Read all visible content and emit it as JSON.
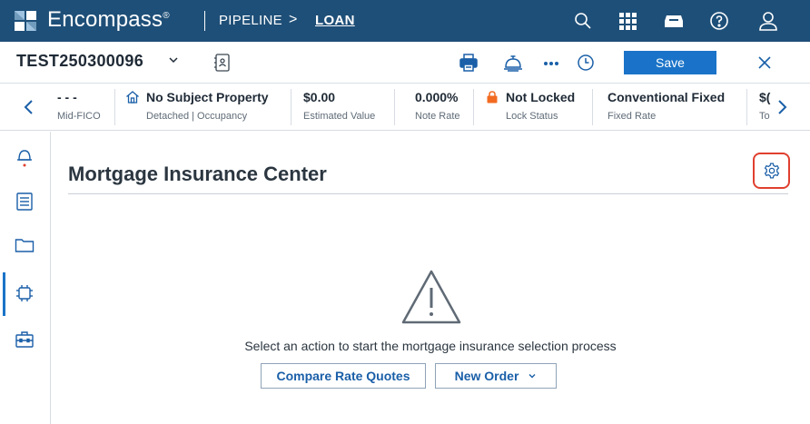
{
  "header": {
    "brand": "Encompass",
    "brand_mark": "®",
    "breadcrumb": {
      "pipeline": "PIPELINE",
      "separator": ">",
      "loan": "LOAN"
    },
    "icons": [
      "search-icon",
      "apps-grid-icon",
      "inbox-icon",
      "help-icon",
      "user-icon"
    ],
    "background": "#1e4f78"
  },
  "titlebar": {
    "loan_number": "TEST250300096",
    "icons": [
      "chevron-down-icon",
      "contact-card-icon",
      "print-icon",
      "service-bell-icon",
      "more-icon",
      "clock-icon",
      "close-icon"
    ],
    "save_label": "Save",
    "accent": "#1a73c8"
  },
  "summary": {
    "items": [
      {
        "value": "- - -",
        "label": "Mid-FICO"
      },
      {
        "value": "No Subject Property",
        "label": "Detached | Occupancy",
        "icon": "home-icon"
      },
      {
        "value": "$0.00",
        "label": "Estimated Value"
      },
      {
        "value": "0.000%",
        "label": "Note Rate"
      },
      {
        "value": "Not Locked",
        "label": "Lock Status",
        "icon": "lock-icon"
      },
      {
        "value": "Conventional Fixed",
        "label": "Fixed Rate"
      },
      {
        "value": "$(",
        "label": "To"
      }
    ],
    "lock_color": "#f26b21"
  },
  "leftnav": {
    "icons": [
      "notification-bell-icon",
      "forms-list-icon",
      "folder-icon",
      "services-chip-icon",
      "toolbox-icon"
    ],
    "active": "services-chip-icon"
  },
  "main": {
    "title": "Mortgage Insurance Center",
    "settings_icon": "gear-icon",
    "highlight_color": "#e0402f",
    "empty_message": "Select an action to start the mortgage insurance selection process",
    "compare_label": "Compare Rate Quotes",
    "new_order_label": "New Order"
  }
}
